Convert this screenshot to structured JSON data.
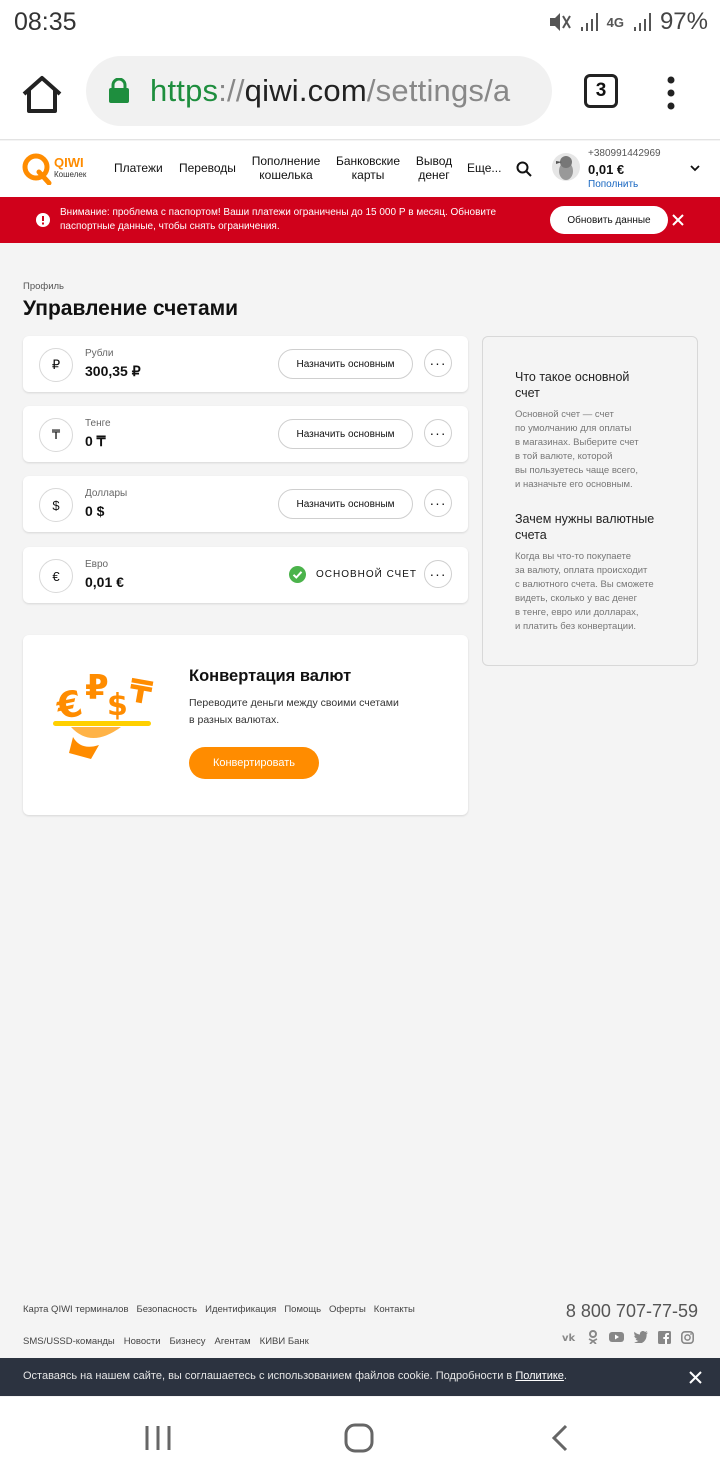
{
  "status_bar": {
    "time": "08:35",
    "network": "4G",
    "battery": "97%"
  },
  "browser": {
    "url_scheme": "https",
    "url_sep": "://",
    "url_host": "qiwi.com",
    "url_path": "/settings/a",
    "tab_count": "3",
    "scheme_color": "#1e8e3e"
  },
  "header": {
    "logo_text": "QIWI",
    "logo_sub": "Кошелек",
    "nav": [
      {
        "label": "Платежи"
      },
      {
        "label": "Переводы"
      },
      {
        "label_1": "Пополнение",
        "label_2": "кошелька"
      },
      {
        "label_1": "Банковские",
        "label_2": "карты"
      },
      {
        "label_1": "Вывод",
        "label_2": "денег"
      },
      {
        "label": "Еще..."
      }
    ],
    "phone": "+380991442969",
    "balance": "0,01 €",
    "topup": "Пополнить"
  },
  "alert": {
    "text": "Внимание: проблема с паспортом! Ваши платежи ограничены до 15 000 Р в месяц. Обновите паспортные данные, чтобы снять ограничения.",
    "button": "Обновить данные",
    "color": "#d0011b"
  },
  "page": {
    "breadcrumb": "Профиль",
    "title": "Управление счетами"
  },
  "accounts": [
    {
      "symbol": "₽",
      "name": "Рубли",
      "value": "300,35 ₽",
      "action": "Назначить основным"
    },
    {
      "symbol": "₸",
      "name": "Тенге",
      "value": "0 ₸",
      "action": "Назначить основным"
    },
    {
      "symbol": "$",
      "name": "Доллары",
      "value": "0 $",
      "action": "Назначить основным"
    },
    {
      "symbol": "€",
      "name": "Евро",
      "value": "0,01 €",
      "main_label": "ОСНОВНОЙ СЧЕТ"
    }
  ],
  "convert": {
    "title": "Конвертация валют",
    "text_1": "Переводите деньги между своими счетами",
    "text_2": "в разных валютах.",
    "button": "Конвертировать",
    "accent": "#ff8c00"
  },
  "side": {
    "h1_1": "Что такое основной",
    "h1_2": "счет",
    "p1": [
      "Основной счет — счет",
      "по умолчанию для оплаты",
      "в магазинах. Выберите счет",
      "в той валюте, которой",
      "вы пользуетесь чаще всего,",
      "и назначьте его основным."
    ],
    "h2_1": "Зачем нужны валютные",
    "h2_2": "счета",
    "p2": [
      "Когда вы что-то покупаете",
      "за валюту, оплата происходит",
      "с валютного счета. Вы сможете",
      "видеть, сколько у вас денег",
      "в тенге, евро или долларах,",
      "и платить без конвертации."
    ]
  },
  "footer": {
    "row1": [
      "Карта QIWI терминалов",
      "Безопасность",
      "Идентификация",
      "Помощь",
      "Оферты",
      "Контакты"
    ],
    "row2": [
      "SMS/USSD-команды",
      "Новости",
      "Бизнесу",
      "Агентам",
      "КИВИ Банк"
    ],
    "phone": "8 800 707-77-59",
    "social": [
      "vk-icon",
      "ok-icon",
      "youtube-icon",
      "twitter-icon",
      "facebook-icon",
      "instagram-icon"
    ]
  },
  "cookie": {
    "text": "Оставаясь на нашем сайте, вы соглашаетесь с использованием файлов cookie. Подробности в",
    "link": "Политике",
    "end": "."
  }
}
